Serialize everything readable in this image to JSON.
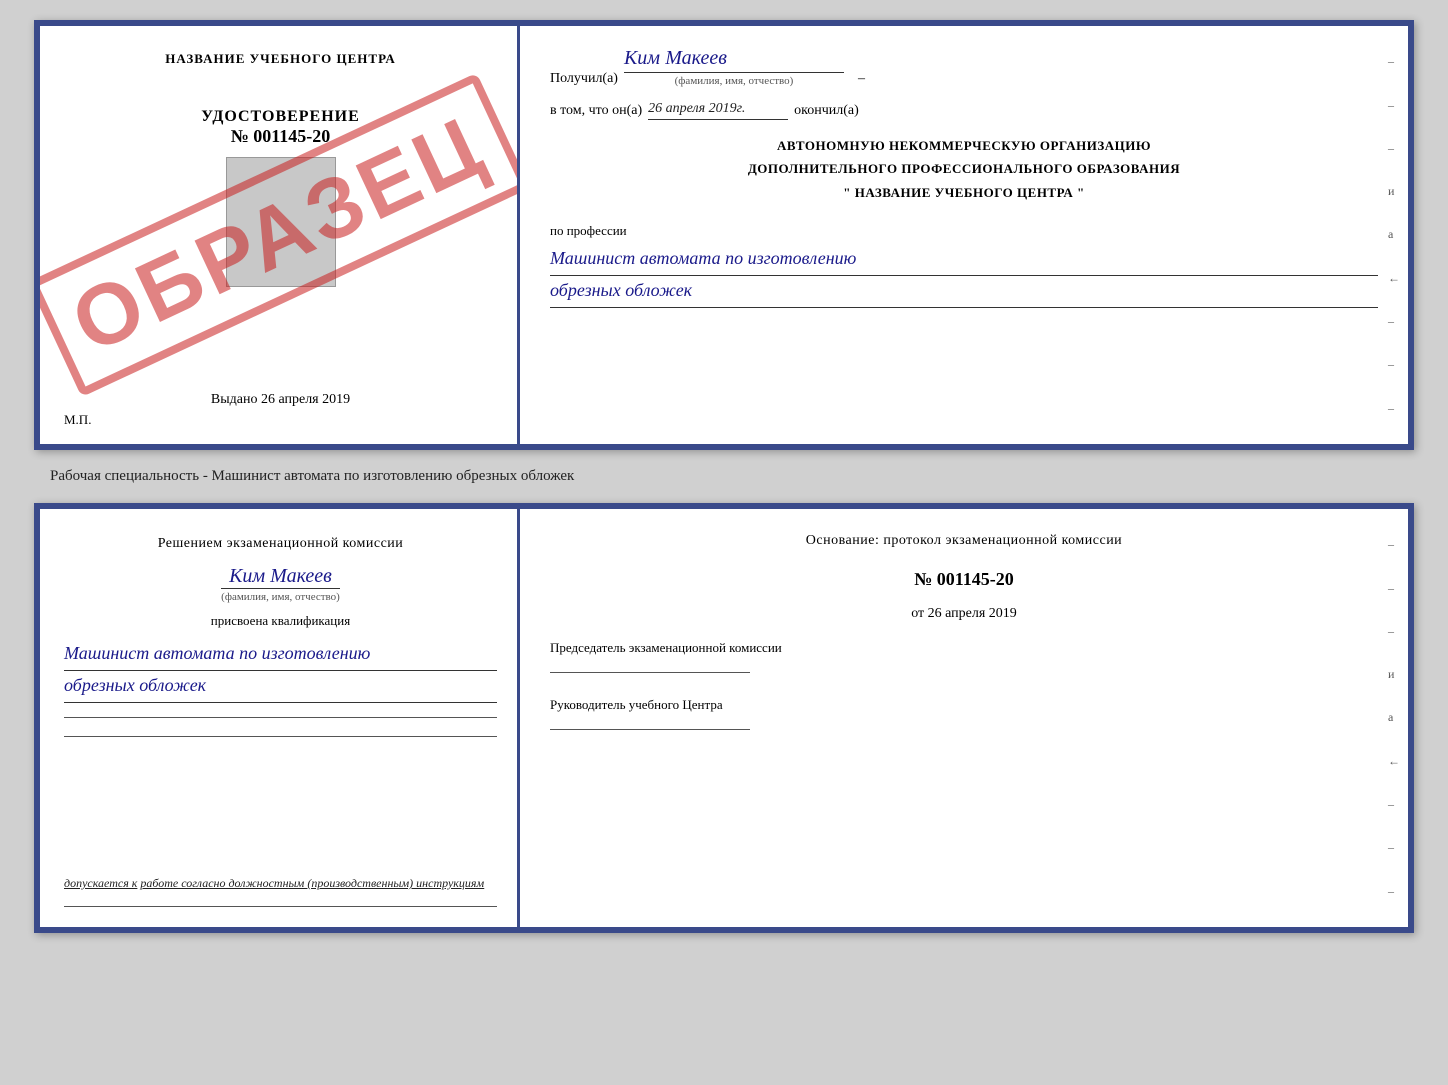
{
  "top_cert": {
    "left": {
      "school_name": "НАЗВАНИЕ УЧЕБНОГО ЦЕНТРА",
      "udostoverenie_label": "УДОСТОВЕРЕНИЕ",
      "number": "№ 001145-20",
      "photo_alt": "Фото",
      "vydano": "Выдано",
      "vydano_date": "26 апреля 2019",
      "mp": "М.П.",
      "stamp": "ОБРАЗЕЦ"
    },
    "right": {
      "poluchil_label": "Получил(а)",
      "name": "Ким Макеев",
      "fio_label": "(фамилия, имя, отчество)",
      "vtom_label": "в том, что он(а)",
      "date": "26 апреля 2019г.",
      "okonchal": "окончил(а)",
      "org_line1": "АВТОНОМНУЮ НЕКОММЕРЧЕСКУЮ ОРГАНИЗАЦИЮ",
      "org_line2": "ДОПОЛНИТЕЛЬНОГО ПРОФЕССИОНАЛЬНОГО ОБРАЗОВАНИЯ",
      "org_line3": "\" НАЗВАНИЕ УЧЕБНОГО ЦЕНТРА \"",
      "po_professii": "по профессии",
      "profession_line1": "Машинист автомата по изготовлению",
      "profession_line2": "обрезных обложек",
      "dash1": "–",
      "dash2": "–",
      "dash3": "–",
      "dash4": "и",
      "dash5": "а",
      "dash6": "←",
      "dash7": "–",
      "dash8": "–",
      "dash9": "–"
    }
  },
  "separator": {
    "text": "Рабочая специальность - Машинист автомата по изготовлению обрезных обложек"
  },
  "bottom_cert": {
    "left": {
      "decision_text": "Решением экзаменационной комиссии",
      "name": "Ким Макеев",
      "fio_label": "(фамилия, имя, отчество)",
      "prisvoena": "присвоена квалификация",
      "profession_line1": "Машинист автомата по изготовлению",
      "profession_line2": "обрезных обложек",
      "dopuskaetsya_prefix": "допускается к",
      "dopuskaetsya_underline": "работе согласно должностным (производственным) инструкциям"
    },
    "right": {
      "osnovaniye": "Основание: протокол экзаменационной комиссии",
      "protocol_number": "№ 001145-20",
      "ot_label": "от",
      "protocol_date": "26 апреля 2019",
      "predsedatel_label": "Председатель экзаменационной комиссии",
      "rukovoditel_label": "Руководитель учебного Центра",
      "dash1": "–",
      "dash2": "–",
      "dash3": "–",
      "dash4": "и",
      "dash5": "а",
      "dash6": "←",
      "dash7": "–",
      "dash8": "–",
      "dash9": "–"
    }
  }
}
